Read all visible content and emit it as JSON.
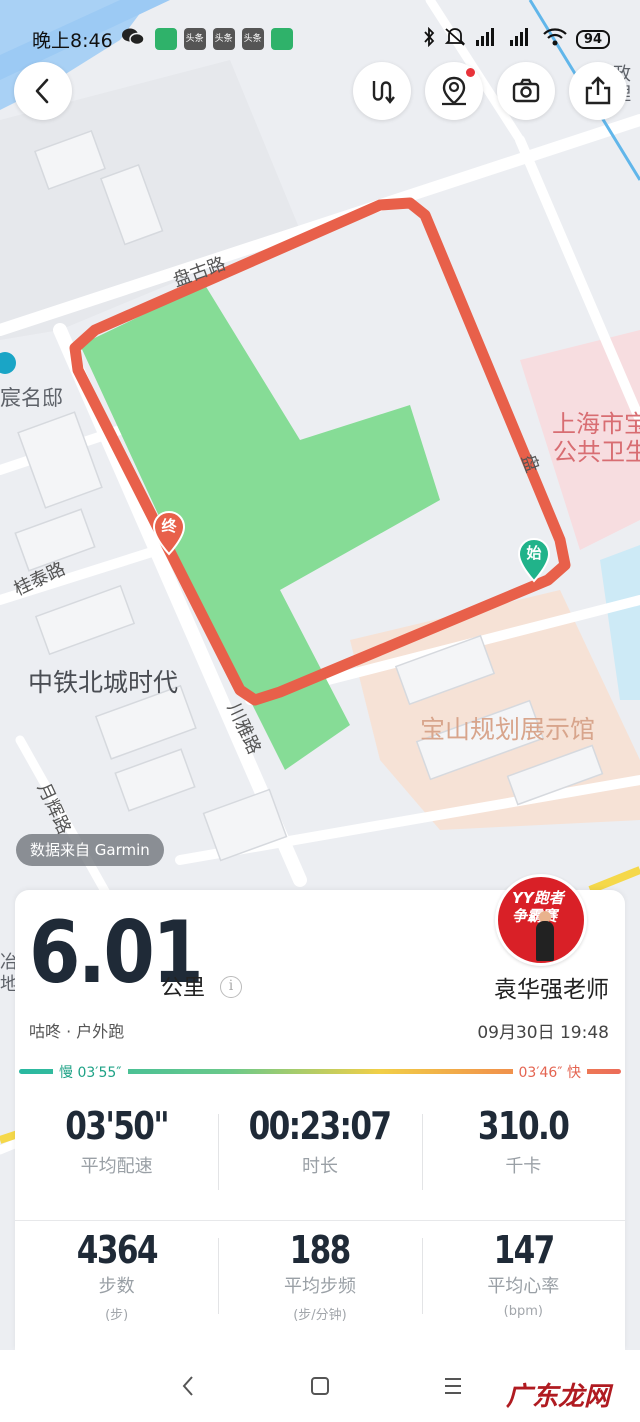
{
  "statusbar": {
    "time": "晚上8:46",
    "news_labels": [
      "头条",
      "头条",
      "头条"
    ],
    "battery": "94"
  },
  "map": {
    "labels": {
      "road_north": "盘古路",
      "poi_west": "宸名邸",
      "poi_east_1": "上海市宝",
      "poi_east_2": "公共卫生",
      "road_west": "桂泰路",
      "community": "中铁北城时代",
      "road_south": "川雅路",
      "hall": "宝山规划展示馆",
      "road_sw": "月辉路",
      "road_east": "盘",
      "poi_edge": "冶",
      "poi_edge2": "地",
      "poi_top": "部政",
      "poi_top2": "处理"
    },
    "marker_end": "终",
    "marker_start": "始",
    "colors": {
      "route": "#e8604a",
      "park": "#86dc96",
      "start": "#21b38a",
      "end": "#e8604a"
    },
    "source": "数据来自 Garmin"
  },
  "toolbar": {
    "back_icon": "chevron-left-icon",
    "route_icon": "route-switch-icon",
    "location_icon": "location-pin-icon",
    "camera_icon": "camera-icon",
    "share_icon": "share-icon"
  },
  "summary": {
    "distance": "6.01",
    "unit": "公里",
    "info": "i",
    "source_line": "咕咚 · 户外跑",
    "user_name": "袁华强老师",
    "datetime": "09月30日 19:48",
    "avatar_text_1": "YY跑者",
    "avatar_text_2": "争霸赛",
    "pace_slow": "慢 03′55″",
    "pace_fast": "03′46″ 快"
  },
  "stats": [
    {
      "value": "03'50\"",
      "label": "平均配速"
    },
    {
      "value": "00:23:07",
      "label": "时长"
    },
    {
      "value": "310.0",
      "label": "千卡"
    },
    {
      "value": "4364",
      "label": "步数",
      "unit": "(步)"
    },
    {
      "value": "188",
      "label": "平均步频",
      "unit": "(步/分钟)"
    },
    {
      "value": "147",
      "label": "平均心率",
      "unit": "(bpm)"
    }
  ],
  "watermark": "广东龙网"
}
